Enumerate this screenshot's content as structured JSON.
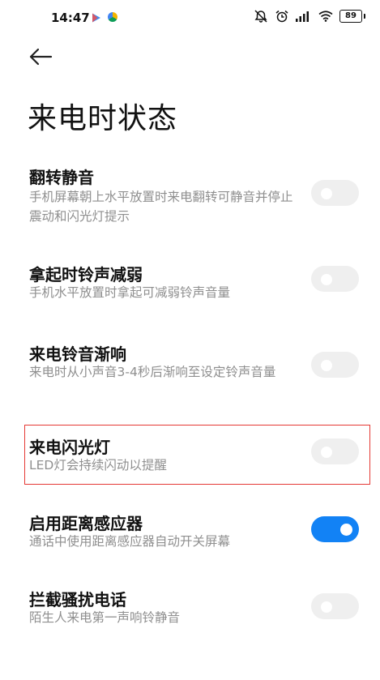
{
  "status_bar": {
    "time": "14:47",
    "battery": "89",
    "icons": [
      "play-store-icon",
      "photos-icon",
      "alarm-off-icon",
      "alarm-clock-icon",
      "signal-icon",
      "wifi-icon",
      "battery-icon"
    ]
  },
  "header": {
    "back_icon": "arrow-left-icon",
    "title": "来电时状态"
  },
  "settings": [
    {
      "title": "翻转静音",
      "desc": "手机屏幕朝上水平放置时来电翻转可静音并停止震动和闪光灯提示",
      "enabled": false
    },
    {
      "title": "拿起时铃声减弱",
      "desc": "手机水平放置时拿起可减弱铃声音量",
      "enabled": false
    },
    {
      "title": "来电铃音渐响",
      "desc": "来电时从小声音3-4秒后渐响至设定铃声音量",
      "enabled": false
    },
    {
      "title": "来电闪光灯",
      "desc": "LED灯会持续闪动以提醒",
      "enabled": false,
      "highlighted": true
    },
    {
      "title": "启用距离感应器",
      "desc": "通话中使用距离感应器自动开关屏幕",
      "enabled": true
    },
    {
      "title": "拦截骚扰电话",
      "desc": "陌生人来电第一声响铃静音",
      "enabled": false
    }
  ],
  "colors": {
    "toggle_on": "#1282f5",
    "toggle_off": "#efefef",
    "highlight": "#e53935",
    "desc_text": "#8f8f8f"
  }
}
